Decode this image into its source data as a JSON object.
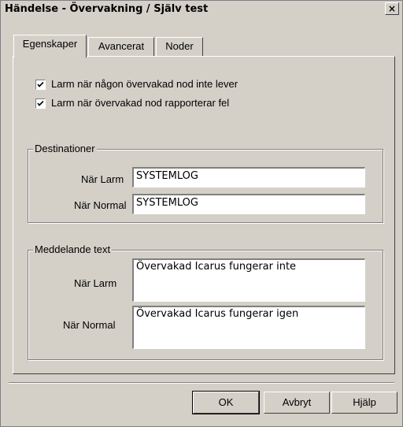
{
  "window": {
    "title": "Händelse - Övervakning / Själv test",
    "close_label": "×"
  },
  "tabs": [
    {
      "label": "Egenskaper",
      "active": true
    },
    {
      "label": "Avancerat",
      "active": false
    },
    {
      "label": "Noder",
      "active": false
    }
  ],
  "checkboxes": [
    {
      "label": "Larm när någon övervakad nod inte lever",
      "checked": true
    },
    {
      "label": "Larm när övervakad nod rapporterar fel",
      "checked": true
    }
  ],
  "destinationer": {
    "legend": "Destinationer",
    "alarm_label": "När Larm",
    "alarm_value": "SYSTEMLOG",
    "normal_label": "När Normal",
    "normal_value": "SYSTEMLOG"
  },
  "meddelande": {
    "legend": "Meddelande text",
    "alarm_label": "När Larm",
    "alarm_value": "Övervakad Icarus fungerar inte",
    "normal_label": "När Normal",
    "normal_value": "Övervakad Icarus fungerar igen"
  },
  "buttons": {
    "ok": "OK",
    "cancel": "Avbryt",
    "help": "Hjälp"
  }
}
